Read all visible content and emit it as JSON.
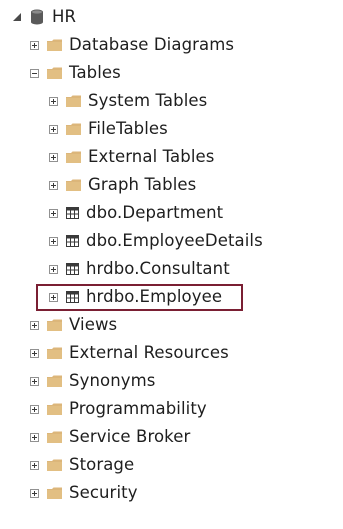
{
  "tree": {
    "root": {
      "label": "HR",
      "icon": "database-icon"
    },
    "level1_folders_top": [
      {
        "label": "Database Diagrams",
        "icon": "folder-icon",
        "expander": "plus"
      },
      {
        "label": "Tables",
        "icon": "folder-icon",
        "expander": "minus"
      }
    ],
    "tables_children": [
      {
        "label": "System Tables",
        "icon": "folder-icon",
        "expander": "plus"
      },
      {
        "label": "FileTables",
        "icon": "folder-icon",
        "expander": "plus"
      },
      {
        "label": "External Tables",
        "icon": "folder-icon",
        "expander": "plus"
      },
      {
        "label": "Graph Tables",
        "icon": "folder-icon",
        "expander": "plus"
      },
      {
        "label": "dbo.Department",
        "icon": "table-icon",
        "expander": "plus"
      },
      {
        "label": "dbo.EmployeeDetails",
        "icon": "table-icon",
        "expander": "plus"
      },
      {
        "label": "hrdbo.Consultant",
        "icon": "table-icon",
        "expander": "plus"
      },
      {
        "label": "hrdbo.Employee",
        "icon": "table-icon",
        "expander": "plus",
        "highlighted": true
      }
    ],
    "level1_folders_bottom": [
      {
        "label": "Views",
        "icon": "folder-icon",
        "expander": "plus"
      },
      {
        "label": "External Resources",
        "icon": "folder-icon",
        "expander": "plus"
      },
      {
        "label": "Synonyms",
        "icon": "folder-icon",
        "expander": "plus"
      },
      {
        "label": "Programmability",
        "icon": "folder-icon",
        "expander": "plus"
      },
      {
        "label": "Service Broker",
        "icon": "folder-icon",
        "expander": "plus"
      },
      {
        "label": "Storage",
        "icon": "folder-icon",
        "expander": "plus"
      },
      {
        "label": "Security",
        "icon": "folder-icon",
        "expander": "plus"
      }
    ]
  },
  "colors": {
    "folder": "#dcb67a",
    "highlight_border": "#7a1f33",
    "text": "#1e1e1e",
    "expander_border": "#919191"
  }
}
